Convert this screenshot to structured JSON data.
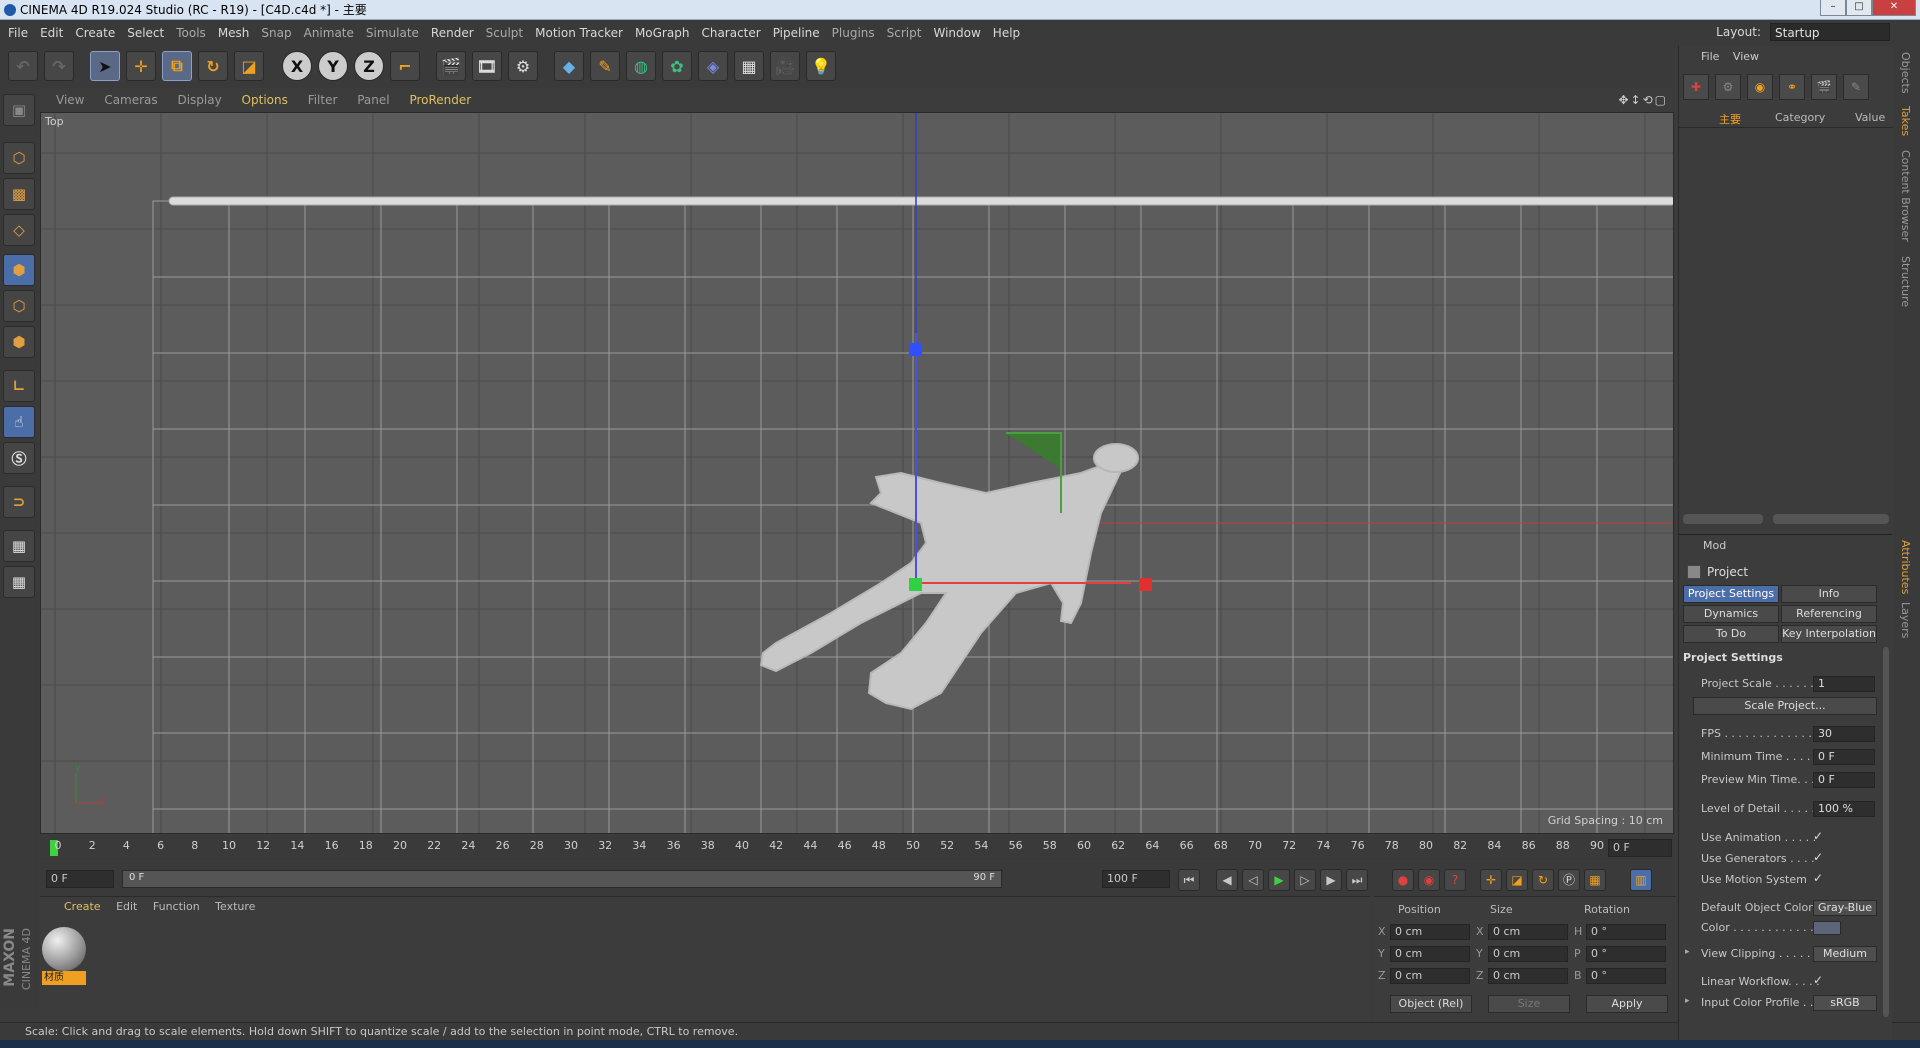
{
  "window": {
    "title": "CINEMA 4D R19.024 Studio (RC - R19) - [C4D.c4d *] - 主要",
    "min": "–",
    "max": "□",
    "close": "✕"
  },
  "menu": [
    "File",
    "Edit",
    "Create",
    "Select",
    "Tools",
    "Mesh",
    "Snap",
    "Animate",
    "Simulate",
    "Render",
    "Sculpt",
    "Motion Tracker",
    "MoGraph",
    "Character",
    "Pipeline",
    "Plugins",
    "Script",
    "Window",
    "Help"
  ],
  "layout": {
    "label": "Layout:",
    "value": "Startup"
  },
  "toolbar": {
    "x_axis": "X",
    "y_axis": "Y",
    "z_axis": "Z"
  },
  "viewport": {
    "menu": [
      "View",
      "Cameras",
      "Display",
      "Options",
      "Filter",
      "Panel",
      "ProRender"
    ],
    "name": "Top",
    "grid_spacing": "Grid Spacing : 10 cm",
    "axis_y": "Y",
    "axis_x": "X"
  },
  "timeline": {
    "ticks": [
      "0",
      "2",
      "4",
      "6",
      "8",
      "10",
      "12",
      "14",
      "16",
      "18",
      "20",
      "22",
      "24",
      "26",
      "28",
      "30",
      "32",
      "34",
      "36",
      "38",
      "40",
      "42",
      "44",
      "46",
      "48",
      "50",
      "52",
      "54",
      "56",
      "58",
      "60",
      "62",
      "64",
      "66",
      "68",
      "70",
      "72",
      "74",
      "76",
      "78",
      "80",
      "82",
      "84",
      "86",
      "88",
      "90"
    ],
    "current": "0 F"
  },
  "transport": {
    "start": "0 F",
    "slider_left": "0 F",
    "slider_right": "90 F",
    "end": "100 F"
  },
  "material": {
    "menu": [
      "Create",
      "Edit",
      "Function",
      "Texture"
    ],
    "item": "材质"
  },
  "coords": {
    "headers": [
      "Position",
      "Size",
      "Rotation"
    ],
    "rows": [
      {
        "pl": "X",
        "pv": "0 cm",
        "sl": "X",
        "sv": "0 cm",
        "rl": "H",
        "rv": "0 °"
      },
      {
        "pl": "Y",
        "pv": "0 cm",
        "sl": "Y",
        "sv": "0 cm",
        "rl": "P",
        "rv": "0 °"
      },
      {
        "pl": "Z",
        "pv": "0 cm",
        "sl": "Z",
        "sv": "0 cm",
        "rl": "B",
        "rv": "0 °"
      }
    ],
    "mode": "Object (Rel)",
    "size_mode": "Size",
    "apply": "Apply"
  },
  "status": "Scale: Click and drag to scale elements. Hold down SHIFT to quantize scale / add to the selection in point mode, CTRL to remove.",
  "objects": {
    "menu": [
      "File",
      "View"
    ],
    "take": "主要",
    "col_category": "Category",
    "col_value": "Value"
  },
  "attributes": {
    "mode": "Mod",
    "title": "Project",
    "tabs": [
      "Project Settings",
      "Info",
      "Dynamics",
      "Referencing",
      "To Do",
      "Key Interpolation"
    ],
    "section": "Project Settings",
    "rows": {
      "project_scale": "Project Scale . . . . . . .",
      "project_scale_val": "1",
      "scale_project": "Scale Project...",
      "fps": "FPS . . . . . . . . . . . . . .",
      "fps_val": "30",
      "min_time": "Minimum Time . . . . .",
      "min_time_val": "0 F",
      "preview_min": "Preview Min Time. . .",
      "preview_min_val": "0 F",
      "lod": "Level of Detail . . . . .",
      "lod_val": "100 %",
      "use_anim": "Use Animation . . . . .",
      "use_gen": "Use Generators . . . .",
      "use_motion": "Use Motion System",
      "def_color": "Default Object Color",
      "def_color_val": "Gray-Blue",
      "color": "Color . . . . . . . . . . . .",
      "view_clip": "View Clipping . . . . . .",
      "view_clip_val": "Medium",
      "linear": "Linear Workflow. . . . .",
      "icp": "Input Color Profile . . .",
      "icp_val": "sRGB"
    },
    "check": "✓"
  },
  "right_tabs": {
    "objects": "Objects",
    "takes": "Takes",
    "content": "Content Browser",
    "structure": "Structure",
    "attributes": "Attributes",
    "layers": "Layers"
  },
  "brand": {
    "maxon": "MAXON",
    "c4d": "CINEMA 4D"
  }
}
